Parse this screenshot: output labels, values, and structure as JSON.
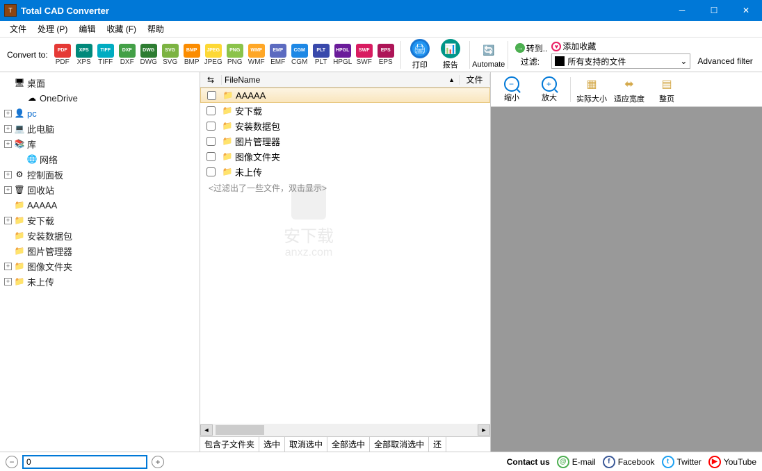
{
  "app": {
    "title": "Total CAD Converter"
  },
  "menu": [
    "文件",
    "处理 (P)",
    "编辑",
    "收藏 (F)",
    "帮助"
  ],
  "toolbar": {
    "convert_label": "Convert to:",
    "formats": [
      {
        "label": "PDF",
        "bg": "#e53935"
      },
      {
        "label": "XPS",
        "bg": "#00897b"
      },
      {
        "label": "TIFF",
        "bg": "#00acc1"
      },
      {
        "label": "DXF",
        "bg": "#43a047"
      },
      {
        "label": "DWG",
        "bg": "#2e7d32"
      },
      {
        "label": "SVG",
        "bg": "#7cb342"
      },
      {
        "label": "BMP",
        "bg": "#fb8c00"
      },
      {
        "label": "JPEG",
        "bg": "#fdd835"
      },
      {
        "label": "PNG",
        "bg": "#8bc34a"
      },
      {
        "label": "WMF",
        "bg": "#ffa726"
      },
      {
        "label": "EMF",
        "bg": "#5c6bc0"
      },
      {
        "label": "CGM",
        "bg": "#1e88e5"
      },
      {
        "label": "PLT",
        "bg": "#3949ab"
      },
      {
        "label": "HPGL",
        "bg": "#6a1b9a"
      },
      {
        "label": "SWF",
        "bg": "#d81b60"
      },
      {
        "label": "EPS",
        "bg": "#ad1457"
      }
    ],
    "print": "打印",
    "report": "报告",
    "automate": "Automate",
    "goto": "转到..",
    "favorite": "添加收藏",
    "filter_label": "过滤:",
    "filter_value": "所有支持的文件",
    "adv_filter": "Advanced filter"
  },
  "tree": [
    {
      "exp": "",
      "icon": "🖥",
      "label": "桌面",
      "color": "#1976d2",
      "indent": 0
    },
    {
      "exp": "",
      "icon": "☁",
      "label": "OneDrive",
      "color": "#0078d7",
      "indent": 1
    },
    {
      "exp": "+",
      "icon": "👤",
      "label": "pc",
      "sel": true,
      "indent": 0
    },
    {
      "exp": "+",
      "icon": "💻",
      "label": "此电脑",
      "indent": 0
    },
    {
      "exp": "+",
      "icon": "📚",
      "label": "库",
      "color": "#0078d7",
      "indent": 0
    },
    {
      "exp": "",
      "icon": "🌐",
      "label": "网络",
      "indent": 1
    },
    {
      "exp": "+",
      "icon": "⚙",
      "label": "控制面板",
      "indent": 0
    },
    {
      "exp": "+",
      "icon": "🗑",
      "label": "回收站",
      "indent": 0
    },
    {
      "exp": "",
      "icon": "📁",
      "label": "AAAAA",
      "folder": true,
      "indent": 0
    },
    {
      "exp": "+",
      "icon": "📁",
      "label": "安下载",
      "folder": true,
      "indent": 0
    },
    {
      "exp": "",
      "icon": "📁",
      "label": "安装数据包",
      "folder": true,
      "indent": 0
    },
    {
      "exp": "",
      "icon": "📁",
      "label": "图片管理器",
      "folder": true,
      "indent": 0
    },
    {
      "exp": "+",
      "icon": "📁",
      "label": "图像文件夹",
      "folder": true,
      "indent": 0
    },
    {
      "exp": "+",
      "icon": "📁",
      "label": "未上传",
      "folder": true,
      "indent": 0
    }
  ],
  "files": {
    "header": {
      "name": "FileName",
      "file": "文件"
    },
    "rows": [
      {
        "name": "AAAAA",
        "sel": true
      },
      {
        "name": "安下载"
      },
      {
        "name": "安装数据包"
      },
      {
        "name": "图片管理器"
      },
      {
        "name": "图像文件夹"
      },
      {
        "name": "未上传"
      }
    ],
    "filtered_msg": "<过滤出了一些文件，双击显示>",
    "watermark": {
      "brand": "安下载",
      "url": "anxz.com"
    },
    "footer": [
      "包含子文件夹",
      "选中",
      "取消选中",
      "全部选中",
      "全部取消选中",
      "还"
    ]
  },
  "preview": {
    "buttons": [
      "缩小",
      "放大",
      "实际大小",
      "适应宽度",
      "整页"
    ]
  },
  "status": {
    "value": "0",
    "contact": "Contact us",
    "links": [
      {
        "label": "E-mail",
        "icon": "@",
        "color": "#4caf50"
      },
      {
        "label": "Facebook",
        "icon": "f",
        "color": "#3b5998"
      },
      {
        "label": "Twitter",
        "icon": "t",
        "color": "#1da1f2"
      },
      {
        "label": "YouTube",
        "icon": "▶",
        "color": "#ff0000"
      }
    ]
  }
}
